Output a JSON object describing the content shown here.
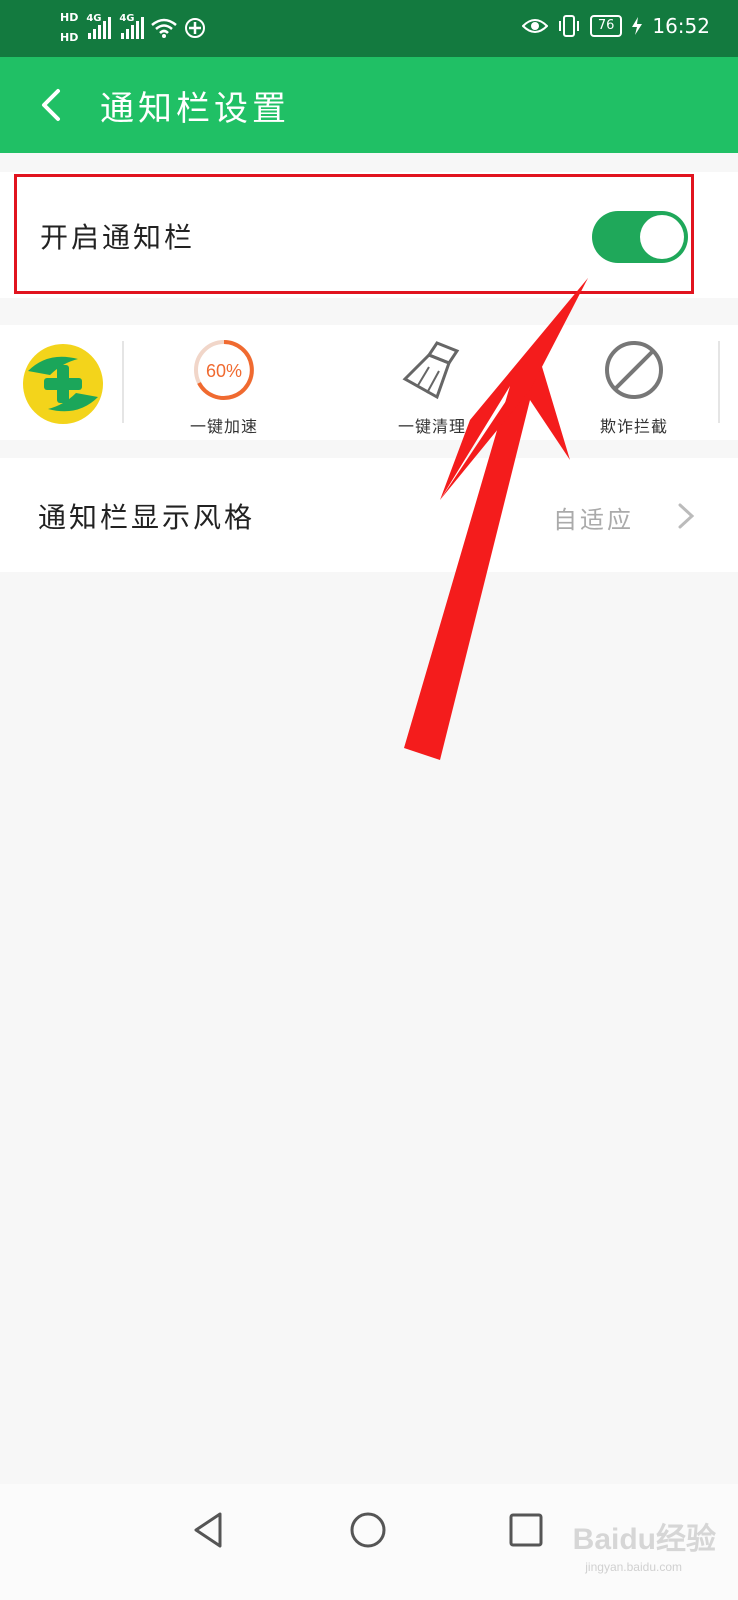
{
  "status_bar": {
    "hd1": "HD",
    "hd2": "HD",
    "net1": "4G",
    "net2": "4G",
    "battery": "76",
    "time": "16:52"
  },
  "app_bar": {
    "title": "通知栏设置"
  },
  "notification_toggle": {
    "label": "开启通知栏",
    "enabled": true
  },
  "quick_actions": {
    "boost_percent": "60%",
    "items": [
      {
        "label": "一键加速"
      },
      {
        "label": "一键清理"
      },
      {
        "label": "欺诈拦截"
      }
    ]
  },
  "display_style": {
    "label": "通知栏显示风格",
    "value": "自适应"
  },
  "colors": {
    "app_bar": "#20c065",
    "status_bar": "#137a3f",
    "switch_on": "#1fa85a",
    "highlight": "#e1141f"
  },
  "watermark": {
    "brand": "Baidu经验",
    "url": "jingyan.baidu.com"
  }
}
